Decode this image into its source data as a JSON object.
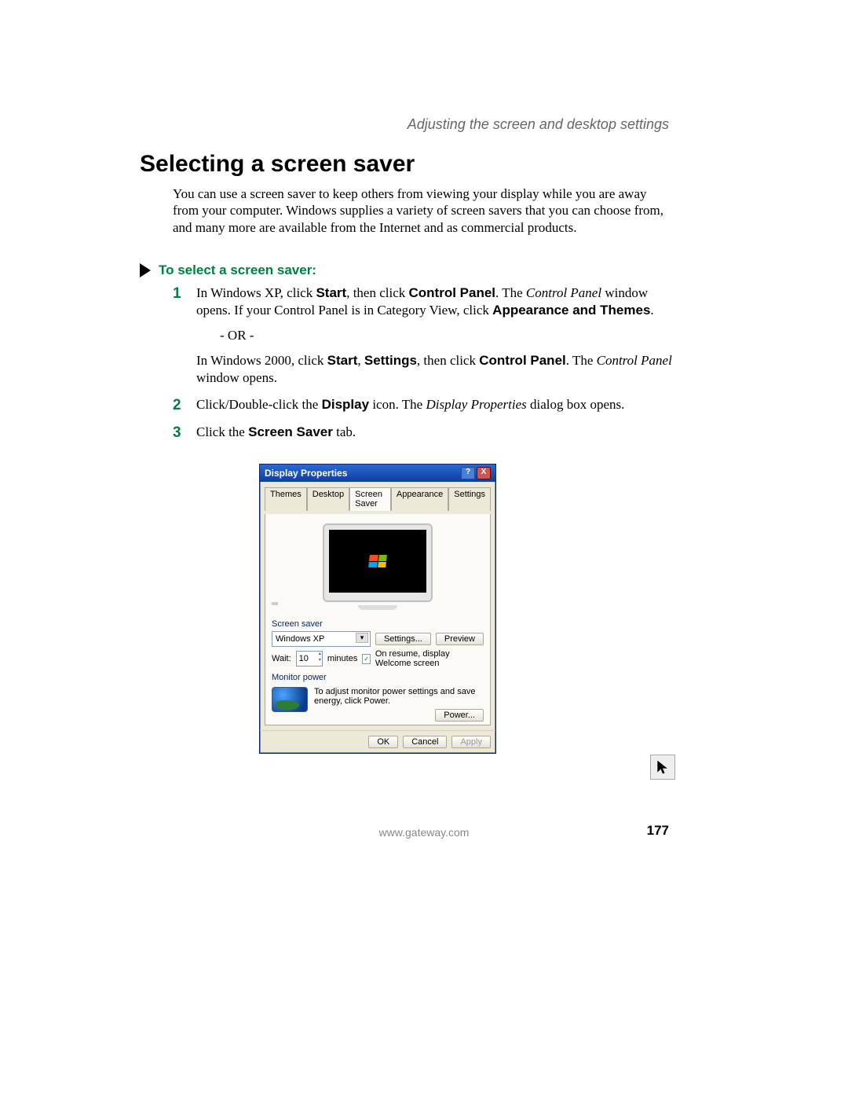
{
  "header": {
    "section": "Adjusting the screen and desktop settings"
  },
  "title": "Selecting a screen saver",
  "intro": "You can use a screen saver to keep others from viewing your display while you are away from your computer. Windows supplies a variety of screen savers that you can choose from, and many more are available from the Internet and as commercial products.",
  "task_heading": "To select a screen saver:",
  "steps": {
    "s1": {
      "num": "1",
      "t1": "In Windows XP, click ",
      "b1": "Start",
      "t2": ", then click ",
      "b2": "Control Panel",
      "t3": ". The ",
      "i1": "Control Panel",
      "t4": " window opens. If your Control Panel is in Category View, click ",
      "b3": "Appearance and Themes",
      "t5": ".",
      "or": "- OR -",
      "t6": "In Windows 2000, click ",
      "b4": "Start",
      "t7": ", ",
      "b5": "Settings",
      "t8": ", then click ",
      "b6": "Control Panel",
      "t9": ". The ",
      "i2": "Control Panel",
      "t10": " window opens."
    },
    "s2": {
      "num": "2",
      "t1": "Click/Double-click the ",
      "b1": "Display",
      "t2": " icon. The ",
      "i1": "Display Properties",
      "t3": " dialog box opens."
    },
    "s3": {
      "num": "3",
      "t1": "Click the ",
      "b1": "Screen Saver",
      "t2": " tab."
    }
  },
  "dialog": {
    "title": "Display Properties",
    "tabs": [
      "Themes",
      "Desktop",
      "Screen Saver",
      "Appearance",
      "Settings"
    ],
    "active_tab_index": 2,
    "group_screensaver": "Screen saver",
    "selected_saver": "Windows XP",
    "settings_btn": "Settings...",
    "preview_btn": "Preview",
    "wait_label": "Wait:",
    "wait_value": "10",
    "minutes_label": "minutes",
    "resume_checked": true,
    "resume_label": "On resume, display Welcome screen",
    "group_power": "Monitor power",
    "power_text": "To adjust monitor power settings and save energy, click Power.",
    "power_btn": "Power...",
    "ok": "OK",
    "cancel": "Cancel",
    "apply": "Apply",
    "help_btn": "?",
    "close_btn": "X"
  },
  "footer": {
    "url": "www.gateway.com",
    "page": "177"
  }
}
